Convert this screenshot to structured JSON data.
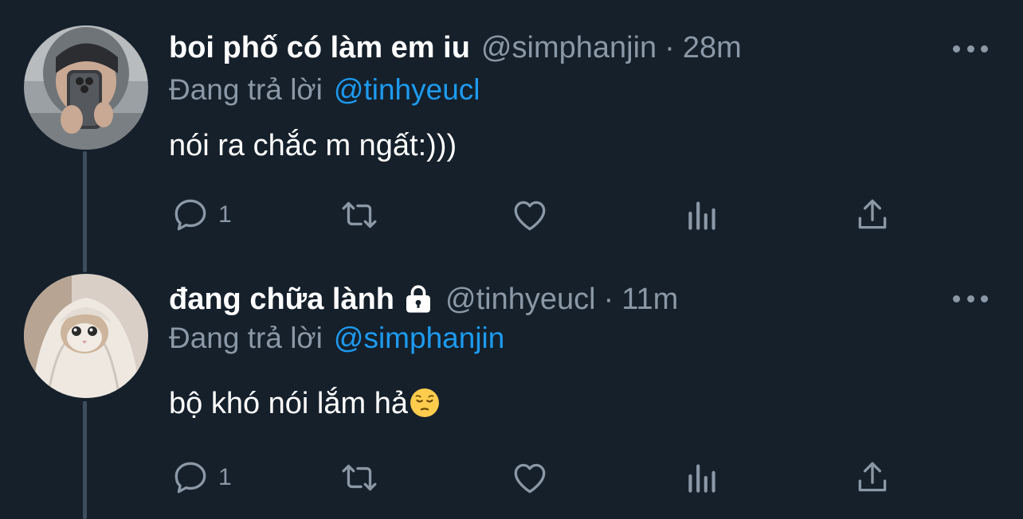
{
  "tweets": [
    {
      "display_name": "boi phố có làm em iu",
      "handle": "@simphanjin",
      "separator": "·",
      "time": "28m",
      "reply_prefix": "Đang trả lời",
      "reply_to": "@tinhyeucl",
      "text": "nói ra chắc m ngất:)))",
      "reply_count": "1",
      "locked": false,
      "avatar": "avatar-man-holding-phone"
    },
    {
      "display_name": "đang chữa lành",
      "handle": "@tinhyeucl",
      "separator": "·",
      "time": "11m",
      "reply_prefix": "Đang trả lời",
      "reply_to": "@simphanjin",
      "text": "bộ khó nói lắm hả",
      "emoji": "pensive-face-emoji",
      "reply_count": "1",
      "locked": true,
      "avatar": "avatar-cat-in-blanket"
    }
  ],
  "colors": {
    "background": "#15202b",
    "secondary_text": "#8b98a5",
    "mention": "#1d9bf0",
    "thread_line": "#3d4d5c"
  },
  "icons": [
    "reply-icon",
    "retweet-icon",
    "like-icon",
    "views-icon",
    "share-icon",
    "more-icon",
    "lock-icon"
  ]
}
